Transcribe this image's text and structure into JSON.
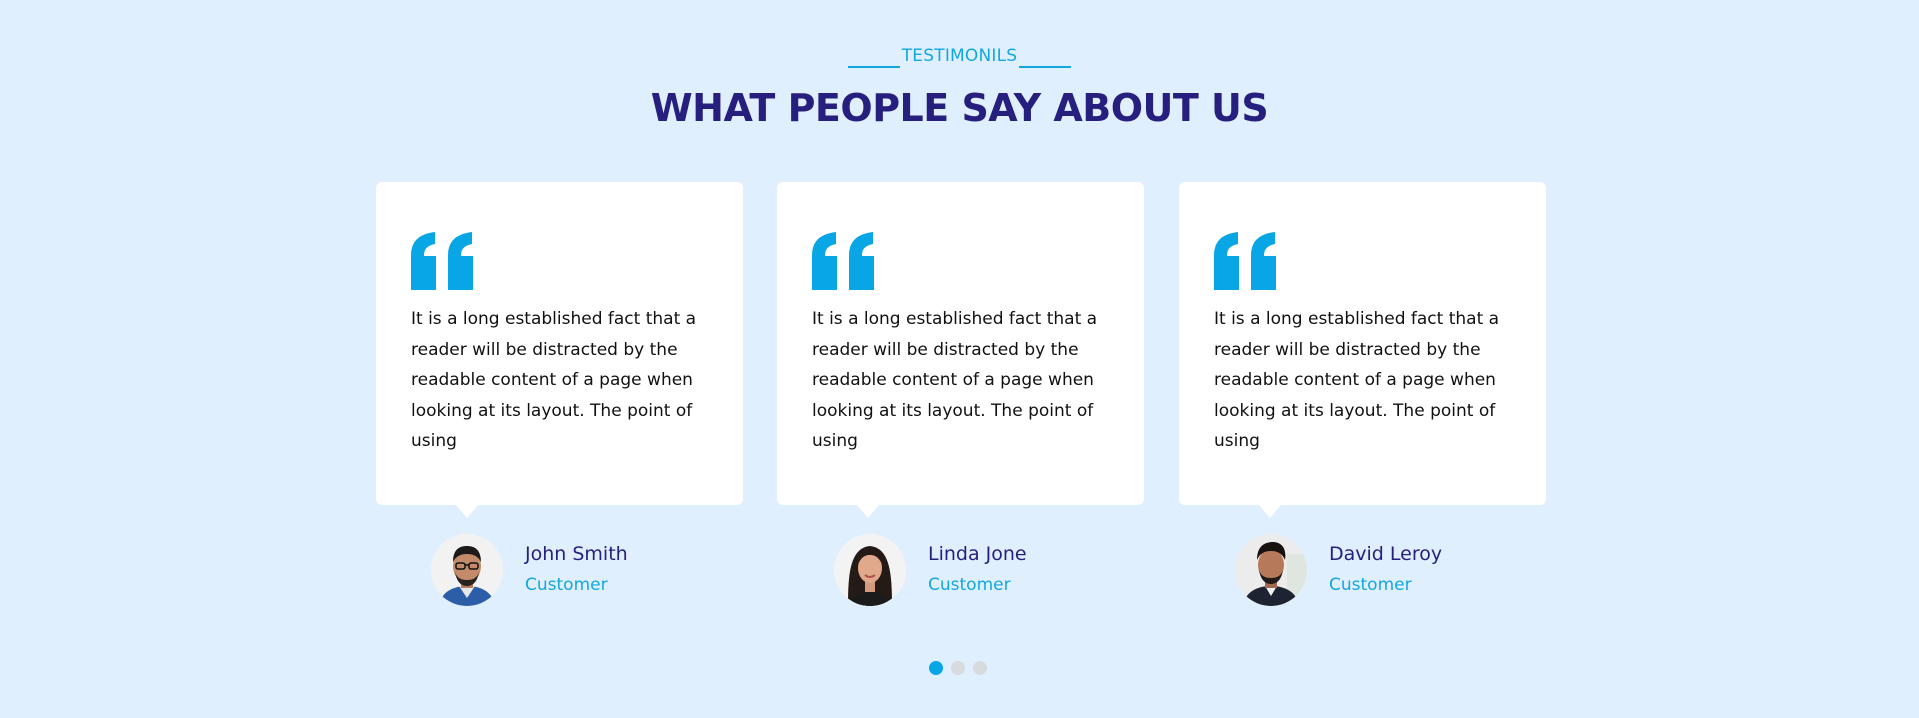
{
  "section": {
    "label": "TESTIMONILS",
    "title": "WHAT PEOPLE SAY ABOUT US"
  },
  "colors": {
    "background": "#e0effd",
    "accent": "#12a8df",
    "quote_icon": "#09a6e6",
    "title": "#271f7d",
    "dot_active": "#09a6e6",
    "dot_inactive": "#d8dbde"
  },
  "testimonials": [
    {
      "quote_icon": "quote-icon",
      "text": "It is a long established fact that a reader will be distracted by the readable content of a page when looking at its layout. The point of using",
      "name": "John Smith",
      "role": "Customer"
    },
    {
      "quote_icon": "quote-icon",
      "text": "It is a long established fact that a reader will be distracted by the readable content of a page when looking at its layout. The point of using",
      "name": "Linda Jone",
      "role": "Customer"
    },
    {
      "quote_icon": "quote-icon",
      "text": "It is a long established fact that a reader will be distracted by the readable content of a page when looking at its layout. The point of using",
      "name": "David Leroy",
      "role": "Customer"
    }
  ],
  "carousel": {
    "total_slides": 3,
    "active_slide": 1
  }
}
